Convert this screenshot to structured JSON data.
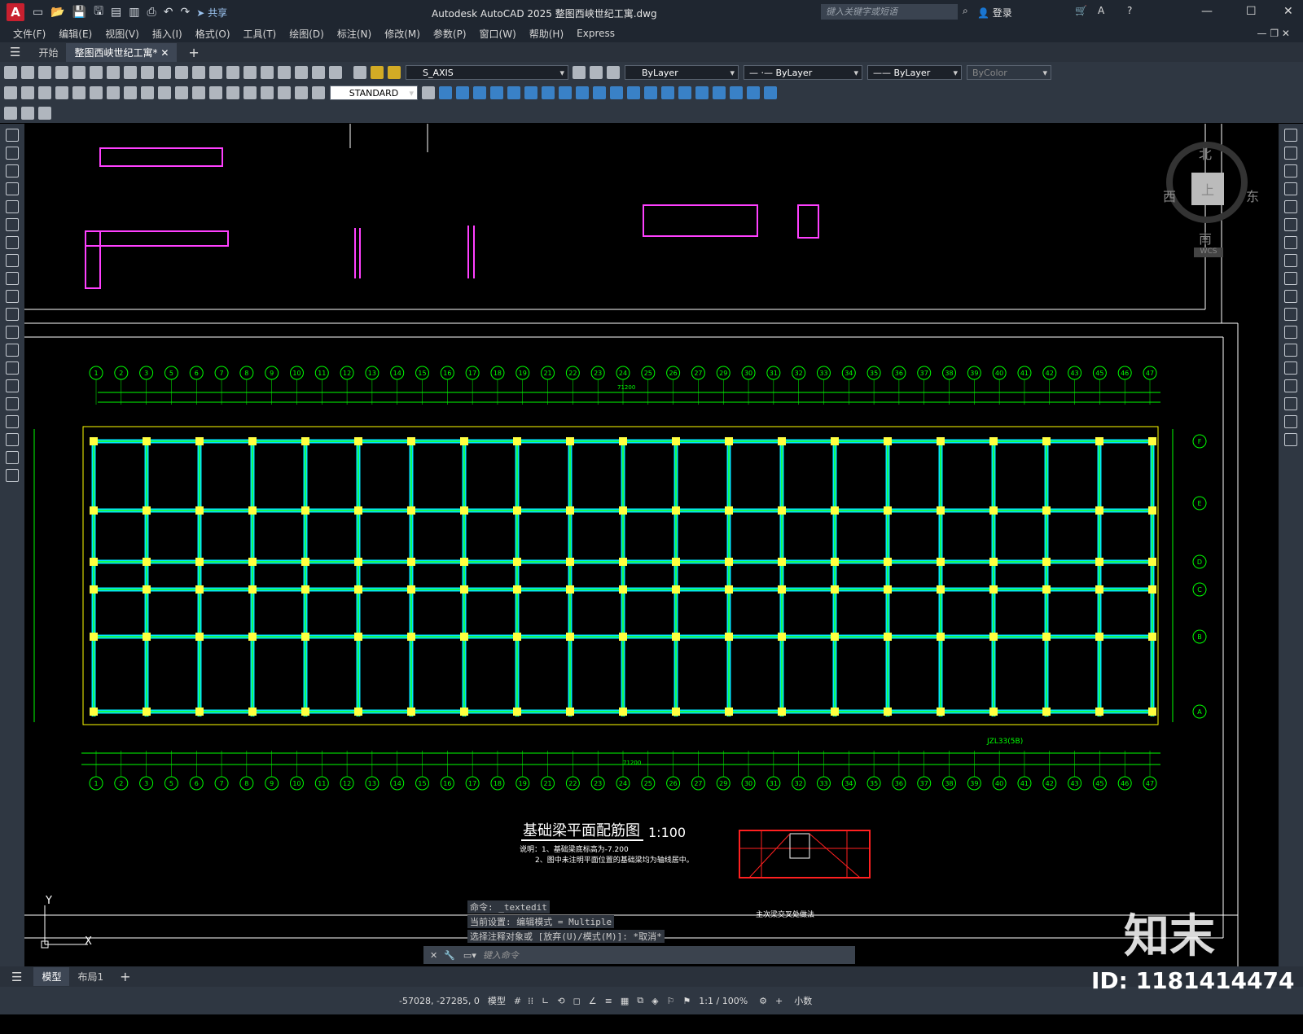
{
  "titlebar": {
    "app_icon": "A",
    "share": "共享",
    "title": "Autodesk AutoCAD 2025    整图西峡世纪工寓.dwg",
    "search_placeholder": "键入关键字或短语",
    "login": "登录"
  },
  "menu": [
    "文件(F)",
    "编辑(E)",
    "视图(V)",
    "插入(I)",
    "格式(O)",
    "工具(T)",
    "绘图(D)",
    "标注(N)",
    "修改(M)",
    "参数(P)",
    "窗口(W)",
    "帮助(H)",
    "Express"
  ],
  "tabs": {
    "start": "开始",
    "doc": "整图西峡世纪工寓*"
  },
  "toolbar": {
    "layer": "S_AXIS",
    "color": "ByLayer",
    "linetype": "ByLayer",
    "lineweight": "ByLayer",
    "plotstyle": "ByColor",
    "textstyle": "STANDARD"
  },
  "compass": {
    "north": "北",
    "south": "南",
    "east": "东",
    "west": "西",
    "center": "上",
    "wcs": "WCS"
  },
  "drawing": {
    "title": "基础梁平面配筋图",
    "scale": "1:100",
    "note1": "说明：1、基础梁底标高为-7.200",
    "note2": "2、图中未注明平面位置的基础梁均为轴线居中。",
    "overall_dim": "71200",
    "beam_label": "JZL33(5B)",
    "detail_caption": "主次梁交叉处做法",
    "top_axes": [
      "1",
      "2",
      "3",
      "5",
      "6",
      "7",
      "8",
      "9",
      "10",
      "11",
      "12",
      "13",
      "14",
      "15",
      "16",
      "17",
      "18",
      "19",
      "21",
      "22",
      "23",
      "24",
      "25",
      "26",
      "27",
      "29",
      "30",
      "31",
      "32",
      "33",
      "34",
      "35",
      "36",
      "37",
      "38",
      "39",
      "40",
      "41",
      "42",
      "43",
      "45",
      "46",
      "47"
    ],
    "right_axes": [
      "F",
      "E",
      "D",
      "C",
      "B",
      "A"
    ]
  },
  "command": {
    "line1": "命令: _textedit",
    "line2": "当前设置: 编辑模式 = Multiple",
    "line3": "选择注释对象或 [放弃(U)/模式(M)]: *取消*",
    "placeholder": "键入命令"
  },
  "layouts": {
    "model": "模型",
    "layout1": "布局1"
  },
  "status": {
    "coords": "-57028, -27285, 0",
    "model": "模型",
    "scale": "1:1 / 100%",
    "units": "小数"
  },
  "watermark": {
    "brand": "知末",
    "id": "ID: 1181414474"
  }
}
